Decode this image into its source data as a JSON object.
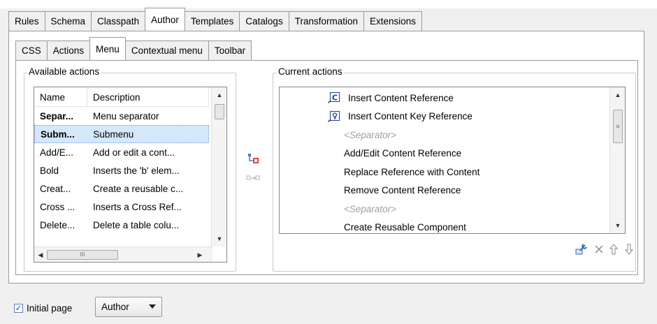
{
  "outer_tabs": [
    "Rules",
    "Schema",
    "Classpath",
    "Author",
    "Templates",
    "Catalogs",
    "Transformation",
    "Extensions"
  ],
  "inner_tabs": [
    "CSS",
    "Actions",
    "Menu",
    "Contextual menu",
    "Toolbar"
  ],
  "available_actions": {
    "label": "Available actions",
    "headers": {
      "name": "Name",
      "description": "Description"
    },
    "rows": [
      {
        "name": "Separ...",
        "description": "Menu separator"
      },
      {
        "name": "Subm...",
        "description": "Submenu"
      },
      {
        "name": "Add/E...",
        "description": "Add or edit a cont..."
      },
      {
        "name": "Bold",
        "description": "Inserts the 'b' elem..."
      },
      {
        "name": "Creat...",
        "description": "Create a reusable c..."
      },
      {
        "name": "Cross ...",
        "description": "Inserts a Cross Ref..."
      },
      {
        "name": "Delete...",
        "description": "Delete a table colu..."
      }
    ],
    "hscroll_thumb_glyph": "III"
  },
  "current_actions": {
    "label": "Current actions",
    "items": [
      {
        "text": "Insert Content Reference",
        "icon": "content-reference-icon",
        "separator": false
      },
      {
        "text": "Insert Content Key Reference",
        "icon": "content-key-reference-icon",
        "separator": false
      },
      {
        "text": "<Separator>",
        "icon": "",
        "separator": true
      },
      {
        "text": "Add/Edit Content Reference",
        "icon": "",
        "separator": false
      },
      {
        "text": "Replace Reference with Content",
        "icon": "",
        "separator": false
      },
      {
        "text": "Remove Content Reference",
        "icon": "",
        "separator": false
      },
      {
        "text": "<Separator>",
        "icon": "",
        "separator": true
      },
      {
        "text": "Create Reusable Component",
        "icon": "",
        "separator": false
      }
    ]
  },
  "initial_page": {
    "label": "Initial page",
    "checked": true
  },
  "select_value": "Author",
  "colors": {
    "selection": "#d5e8fb",
    "panel_background": "#ffffff",
    "window_background": "#f0f0f0",
    "separator_text": "#a0a0a0",
    "add_icon_red": "#e0302a"
  },
  "icons": [
    "add-to-menu-icon",
    "remove-from-menu-icon",
    "edit-wrench-icon",
    "delete-x-icon",
    "move-up-icon",
    "move-down-icon",
    "checkbox-checked-icon",
    "chevron-down-icon"
  ]
}
